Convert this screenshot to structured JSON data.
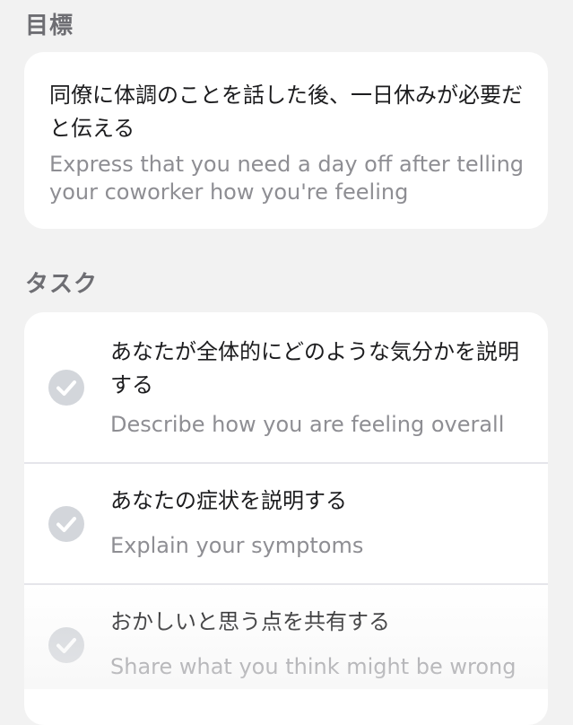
{
  "goal": {
    "section_title": "目標",
    "text_jp": "同僚に体調のことを話した後、一日休みが必要だと伝える",
    "text_en": "Express that you need a day off after telling your coworker how you're feeling"
  },
  "tasks": {
    "section_title": "タスク",
    "items": [
      {
        "text_jp": "あなたが全体的にどのような気分かを説明する",
        "text_en": "Describe how you are feeling overall",
        "icon": "check-circle-icon"
      },
      {
        "text_jp": "あなたの症状を説明する",
        "text_en": "Explain your symptoms",
        "icon": "check-circle-icon"
      },
      {
        "text_jp": "おかしいと思う点を共有する",
        "text_en": "Share what you think might be wrong",
        "icon": "check-circle-icon"
      }
    ]
  },
  "colors": {
    "background": "#f2f2f2",
    "card": "#ffffff",
    "primary_text": "#1c1c1e",
    "secondary_text": "#8e8e93",
    "check_circle": "#d3d6db"
  }
}
